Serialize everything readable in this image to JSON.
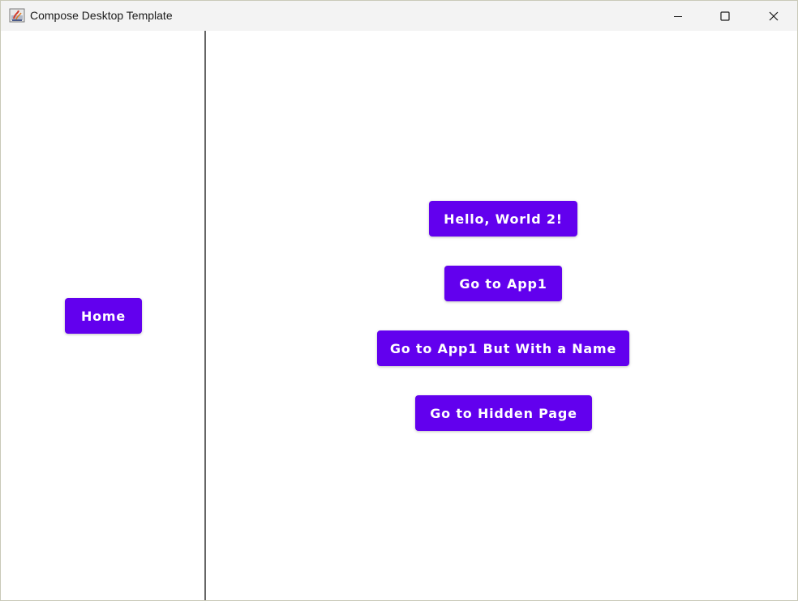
{
  "window": {
    "title": "Compose Desktop Template",
    "icon": "java-app-icon",
    "controls": {
      "minimize_icon": "minimize-icon",
      "maximize_icon": "maximize-icon",
      "close_icon": "close-icon"
    }
  },
  "sidebar": {
    "home_label": "Home"
  },
  "main": {
    "buttons": [
      {
        "label": "Hello, World 2!"
      },
      {
        "label": "Go to App1"
      },
      {
        "label": "Go to App1 But With a Name"
      },
      {
        "label": "Go to Hidden Page"
      }
    ]
  },
  "colors": {
    "button_background": "#6200ee",
    "button_text": "#ffffff",
    "titlebar_background": "#f3f3f3",
    "divider": "#666666"
  }
}
